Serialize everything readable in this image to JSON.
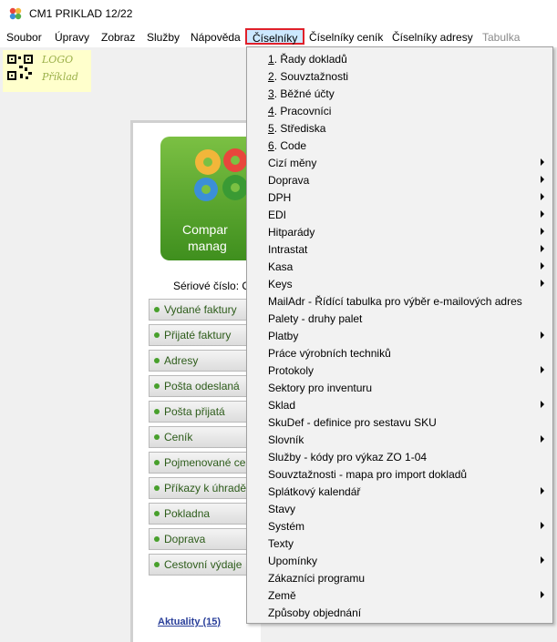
{
  "window": {
    "title": "CM1 PRIKLAD 12/22"
  },
  "menubar": {
    "items": [
      {
        "label": "Soubor"
      },
      {
        "label": "Úpravy"
      },
      {
        "label": "Zobraz"
      },
      {
        "label": "Služby"
      },
      {
        "label": "Nápověda"
      },
      {
        "label": "Číselníky"
      },
      {
        "label": "Číselníky ceník"
      },
      {
        "label": "Číselníky adresy"
      },
      {
        "label": "Tabulka"
      }
    ]
  },
  "logo": {
    "line1": "LOGO",
    "line2": "Příklad"
  },
  "product": {
    "line1": "Compar",
    "line2": "manag"
  },
  "serial_label": "Sériové číslo: C",
  "nav_buttons": [
    {
      "label": "Vydané faktury"
    },
    {
      "label": "Přijaté faktury"
    },
    {
      "label": "Adresy"
    },
    {
      "label": "Pošta odeslaná"
    },
    {
      "label": "Pošta přijatá"
    },
    {
      "label": "Ceník"
    },
    {
      "label": "Pojmenované ce"
    },
    {
      "label": "Příkazy k úhradě"
    },
    {
      "label": "Pokladna"
    },
    {
      "label": "Doprava"
    },
    {
      "label": "Cestovní výdaje"
    }
  ],
  "news_link": "Aktuality (15)",
  "dropdown": {
    "items": [
      {
        "num": "1",
        "rest": ". Řady dokladů",
        "submenu": false
      },
      {
        "num": "2",
        "rest": ". Souvztažnosti",
        "submenu": false
      },
      {
        "num": "3",
        "rest": ". Běžné účty",
        "submenu": false
      },
      {
        "num": "4",
        "rest": ". Pracovníci",
        "submenu": false
      },
      {
        "num": "5",
        "rest": ". Střediska",
        "submenu": false
      },
      {
        "num": "6",
        "rest": ". Code",
        "submenu": false
      },
      {
        "num": "",
        "rest": "Cizí měny",
        "submenu": true
      },
      {
        "num": "",
        "rest": "Doprava",
        "submenu": true
      },
      {
        "num": "",
        "rest": "DPH",
        "submenu": true
      },
      {
        "num": "",
        "rest": "EDI",
        "submenu": true
      },
      {
        "num": "",
        "rest": "Hitparády",
        "submenu": true
      },
      {
        "num": "",
        "rest": "Intrastat",
        "submenu": true
      },
      {
        "num": "",
        "rest": "Kasa",
        "submenu": true
      },
      {
        "num": "",
        "rest": "Keys",
        "submenu": true
      },
      {
        "num": "",
        "rest": "MailAdr - Řídící tabulka pro výběr e-mailových adres",
        "submenu": false
      },
      {
        "num": "",
        "rest": "Palety - druhy palet",
        "submenu": false
      },
      {
        "num": "",
        "rest": "Platby",
        "submenu": true
      },
      {
        "num": "",
        "rest": "Práce výrobních techniků",
        "submenu": false
      },
      {
        "num": "",
        "rest": "Protokoly",
        "submenu": true
      },
      {
        "num": "",
        "rest": "Sektory pro inventuru",
        "submenu": false
      },
      {
        "num": "",
        "rest": "Sklad",
        "submenu": true
      },
      {
        "num": "",
        "rest": "SkuDef - definice pro sestavu SKU",
        "submenu": false
      },
      {
        "num": "",
        "rest": "Slovník",
        "submenu": true
      },
      {
        "num": "",
        "rest": "Služby - kódy pro výkaz ZO 1-04",
        "submenu": false
      },
      {
        "num": "",
        "rest": "Souvztažnosti - mapa pro import dokladů",
        "submenu": false
      },
      {
        "num": "",
        "rest": "Splátkový kalendář",
        "submenu": true
      },
      {
        "num": "",
        "rest": "Stavy",
        "submenu": false
      },
      {
        "num": "",
        "rest": "Systém",
        "submenu": true
      },
      {
        "num": "",
        "rest": "Texty",
        "submenu": false
      },
      {
        "num": "",
        "rest": "Upomínky",
        "submenu": true
      },
      {
        "num": "",
        "rest": "Zákazníci programu",
        "submenu": false
      },
      {
        "num": "",
        "rest": "Země",
        "submenu": true
      },
      {
        "num": "",
        "rest": "Způsoby objednání",
        "submenu": false
      }
    ]
  }
}
